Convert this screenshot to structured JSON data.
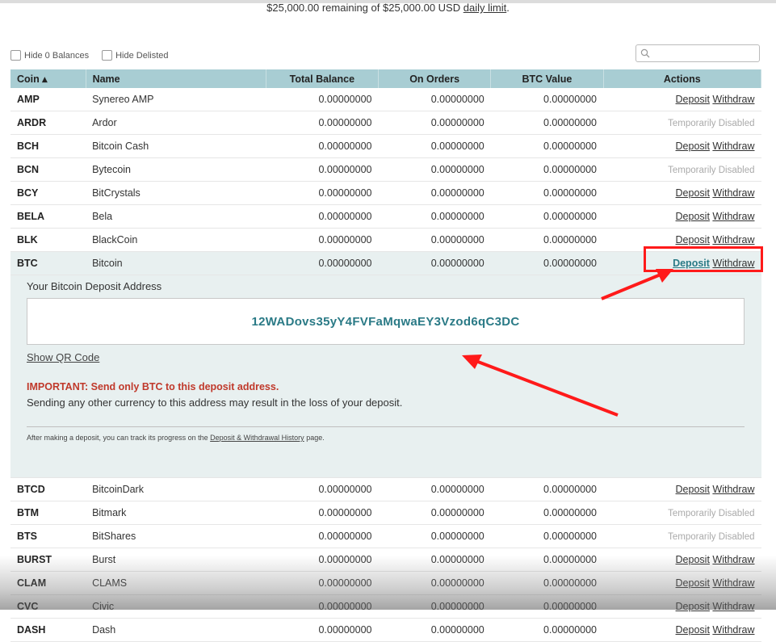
{
  "header": {
    "limit_text": "$25,000.00 remaining of $25,000.00 USD",
    "limit_link": "daily limit",
    "limit_period": "."
  },
  "filters": {
    "hide_zero": "Hide 0 Balances",
    "hide_delisted": "Hide Delisted",
    "search_placeholder": ""
  },
  "table": {
    "headers": {
      "coin": "Coin ▴",
      "name": "Name",
      "total": "Total Balance",
      "on_orders": "On Orders",
      "btc_value": "BTC Value",
      "actions": "Actions"
    },
    "deposit_label": "Deposit",
    "withdraw_label": "Withdraw",
    "disabled_label": "Temporarily Disabled",
    "rows_top": [
      {
        "coin": "AMP",
        "name": "Synereo AMP",
        "total": "0.00000000",
        "orders": "0.00000000",
        "btc": "0.00000000"
      },
      {
        "coin": "ARDR",
        "name": "Ardor",
        "total": "0.00000000",
        "orders": "0.00000000",
        "btc": "0.00000000"
      },
      {
        "coin": "BCH",
        "name": "Bitcoin Cash",
        "total": "0.00000000",
        "orders": "0.00000000",
        "btc": "0.00000000"
      },
      {
        "coin": "BCN",
        "name": "Bytecoin",
        "total": "0.00000000",
        "orders": "0.00000000",
        "btc": "0.00000000"
      },
      {
        "coin": "BCY",
        "name": "BitCrystals",
        "total": "0.00000000",
        "orders": "0.00000000",
        "btc": "0.00000000"
      },
      {
        "coin": "BELA",
        "name": "Bela",
        "total": "0.00000000",
        "orders": "0.00000000",
        "btc": "0.00000000"
      },
      {
        "coin": "BLK",
        "name": "BlackCoin",
        "total": "0.00000000",
        "orders": "0.00000000",
        "btc": "0.00000000"
      },
      {
        "coin": "BTC",
        "name": "Bitcoin",
        "total": "0.00000000",
        "orders": "0.00000000",
        "btc": "0.00000000"
      }
    ],
    "rows_bottom": [
      {
        "coin": "BTCD",
        "name": "BitcoinDark",
        "total": "0.00000000",
        "orders": "0.00000000",
        "btc": "0.00000000"
      },
      {
        "coin": "BTM",
        "name": "Bitmark",
        "total": "0.00000000",
        "orders": "0.00000000",
        "btc": "0.00000000"
      },
      {
        "coin": "BTS",
        "name": "BitShares",
        "total": "0.00000000",
        "orders": "0.00000000",
        "btc": "0.00000000"
      },
      {
        "coin": "BURST",
        "name": "Burst",
        "total": "0.00000000",
        "orders": "0.00000000",
        "btc": "0.00000000"
      },
      {
        "coin": "CLAM",
        "name": "CLAMS",
        "total": "0.00000000",
        "orders": "0.00000000",
        "btc": "0.00000000"
      },
      {
        "coin": "CVC",
        "name": "Civic",
        "total": "0.00000000",
        "orders": "0.00000000",
        "btc": "0.00000000"
      },
      {
        "coin": "DASH",
        "name": "Dash",
        "total": "0.00000000",
        "orders": "0.00000000",
        "btc": "0.00000000"
      }
    ]
  },
  "deposit_panel": {
    "label": "Your Bitcoin Deposit Address",
    "address": "12WADovs35yY4FVFaMqwaEY3Vzod6qC3DC",
    "qr_link": "Show QR Code",
    "important": "IMPORTANT: Send only BTC to this deposit address.",
    "warning": "Sending any other currency to this address may result in the loss of your deposit.",
    "track_prefix": "After making a deposit, you can track its progress on the",
    "track_link": "Deposit & Withdrawal History",
    "track_suffix": "page."
  },
  "colors": {
    "header_bg": "#a8cdd3",
    "accent_teal": "#2a7a86",
    "panel_bg": "#e8f0f0",
    "important_red": "#c0392b",
    "annotation_red": "#ff1a1a"
  }
}
